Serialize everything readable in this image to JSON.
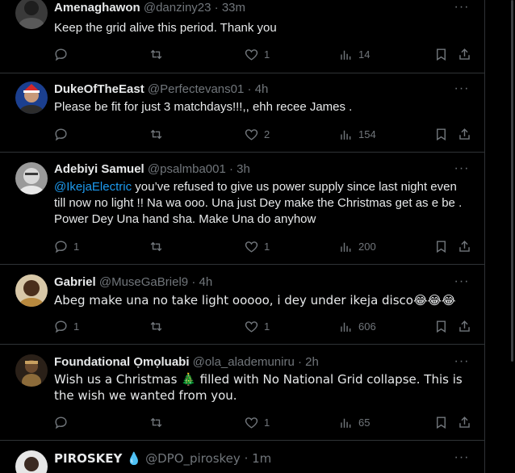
{
  "tweets": [
    {
      "name": "Amenaghawon",
      "handle": "@danziny23",
      "time": "33m",
      "text": "Keep the grid alive this period. Thank you",
      "counts": {
        "reply": "",
        "retweet": "",
        "like": "1",
        "views": "14"
      }
    },
    {
      "name": "DukeOfTheEast",
      "handle": "@Perfectevans01",
      "time": "4h",
      "text": "Please be fit for just 3 matchdays!!!,, ehh recee James .",
      "counts": {
        "reply": "",
        "retweet": "",
        "like": "2",
        "views": "154"
      }
    },
    {
      "name": "Adebiyi Samuel",
      "handle": "@psalmba001",
      "time": "3h",
      "mention": "@IkejaElectric",
      "text": " you’ve refused to give us power supply since last night even till now no light !! Na wa ooo. Una just Dey make the Christmas get as e be . Power Dey Una hand sha. Make Una do anyhow",
      "counts": {
        "reply": "1",
        "retweet": "",
        "like": "1",
        "views": "200"
      }
    },
    {
      "name": "Gabriel",
      "handle": "@MuseGaBriel9",
      "time": "4h",
      "text": "Abeg make una no take light ooooo, i dey under ikeja disco😂😂😂",
      "counts": {
        "reply": "1",
        "retweet": "",
        "like": "1",
        "views": "606"
      }
    },
    {
      "name": "Foundational Ọmọluabi",
      "handle": "@ola_alademuniru",
      "time": "2h",
      "text": "Wish us a Christmas 🎄 filled with No National Grid collapse. This is the wish we wanted from you.",
      "counts": {
        "reply": "",
        "retweet": "",
        "like": "1",
        "views": "65"
      }
    },
    {
      "name": "PIROSKEY 💧",
      "handle": "@DPO_piroskey",
      "time": "1m"
    }
  ],
  "more_label": "···",
  "dot": "·",
  "colors": {
    "accent": "#1d9bf0",
    "muted": "#71767b",
    "text": "#e7e9ea",
    "divider": "#2f3336"
  }
}
